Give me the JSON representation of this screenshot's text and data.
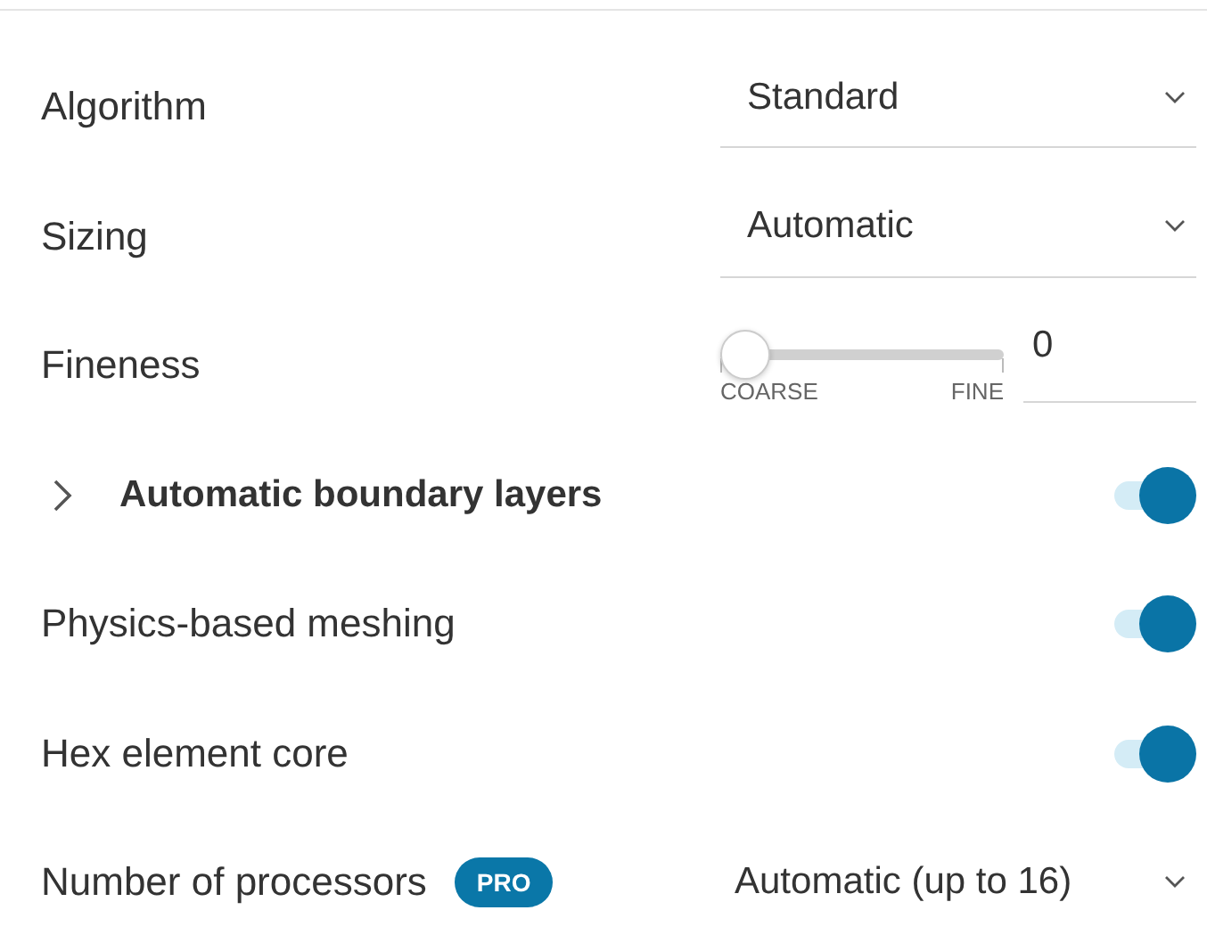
{
  "rows": [
    {
      "kind": "select",
      "label": "Algorithm",
      "value": "Standard"
    },
    {
      "kind": "select",
      "label": "Sizing",
      "value": "Automatic"
    },
    {
      "kind": "slider",
      "label": "Fineness",
      "level": 0,
      "reading": "0",
      "min_label": "COARSE",
      "max_label": "FINE"
    },
    {
      "kind": "toggle",
      "label": "Automatic boundary layers",
      "expandable": true,
      "expanded": false,
      "on": true
    },
    {
      "kind": "toggle",
      "label": "Physics-based meshing",
      "on": true
    },
    {
      "kind": "toggle",
      "label": "Hex element core",
      "on": true
    },
    {
      "kind": "select_plain",
      "label": "Number of processors",
      "badge": "PRO",
      "value": "Automatic (up to 16)"
    }
  ]
}
